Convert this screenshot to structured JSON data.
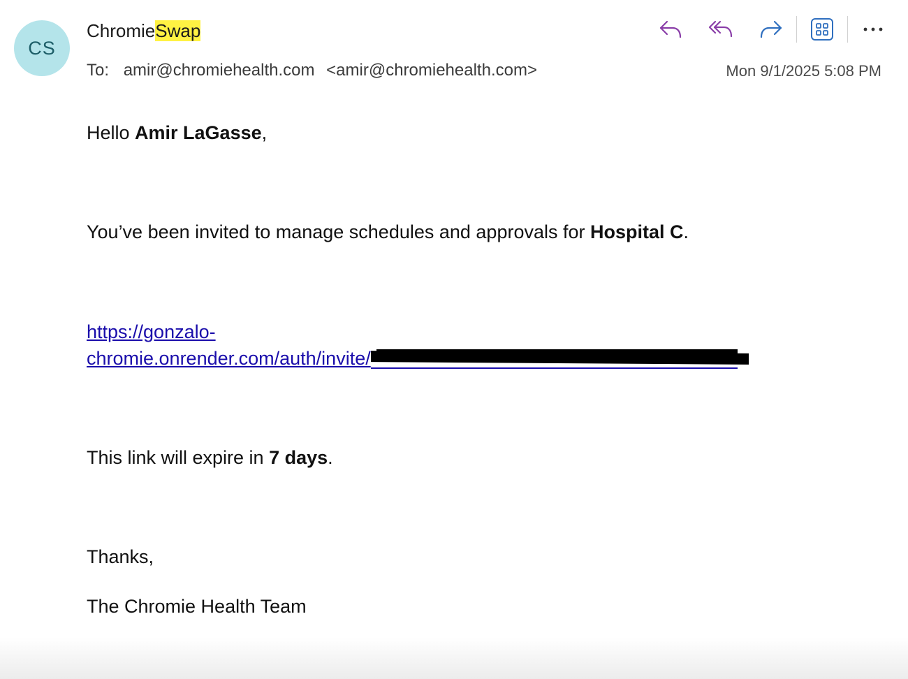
{
  "sender": {
    "initials": "CS",
    "name_part1": "Chromie",
    "name_part2_highlighted": "Swap"
  },
  "recipient": {
    "label": "To:",
    "address": "amir@chromiehealth.com",
    "address_full": "<amir@chromiehealth.com>"
  },
  "date": "Mon 9/1/2025 5:08 PM",
  "toolbar": {
    "reply_icon": "reply-icon",
    "reply_all_icon": "reply-all-icon",
    "forward_icon": "forward-icon",
    "apps_icon": "apps-grid-icon",
    "more_icon": "more-options-icon",
    "accent_purple": "#8a3ea8",
    "accent_blue": "#2f6fbf"
  },
  "body": {
    "greeting_prefix": "Hello ",
    "greeting_name": "Amir LaGasse",
    "greeting_suffix": ",",
    "invite_prefix": "You’ve been invited to manage schedules and approvals for ",
    "invite_hospital": "Hospital C",
    "invite_suffix": ".",
    "link_line1": "https://gonzalo-",
    "link_line2": "chromie.onrender.com/auth/invite/",
    "expire_prefix": "This link will expire in ",
    "expire_days": "7 days",
    "expire_suffix": ".",
    "thanks": "Thanks,",
    "signature": "The Chromie Health Team"
  },
  "colors": {
    "avatar_bg": "#b4e4ea",
    "avatar_text": "#1d5e68",
    "highlight": "#fff243",
    "link": "#1a0dab"
  }
}
